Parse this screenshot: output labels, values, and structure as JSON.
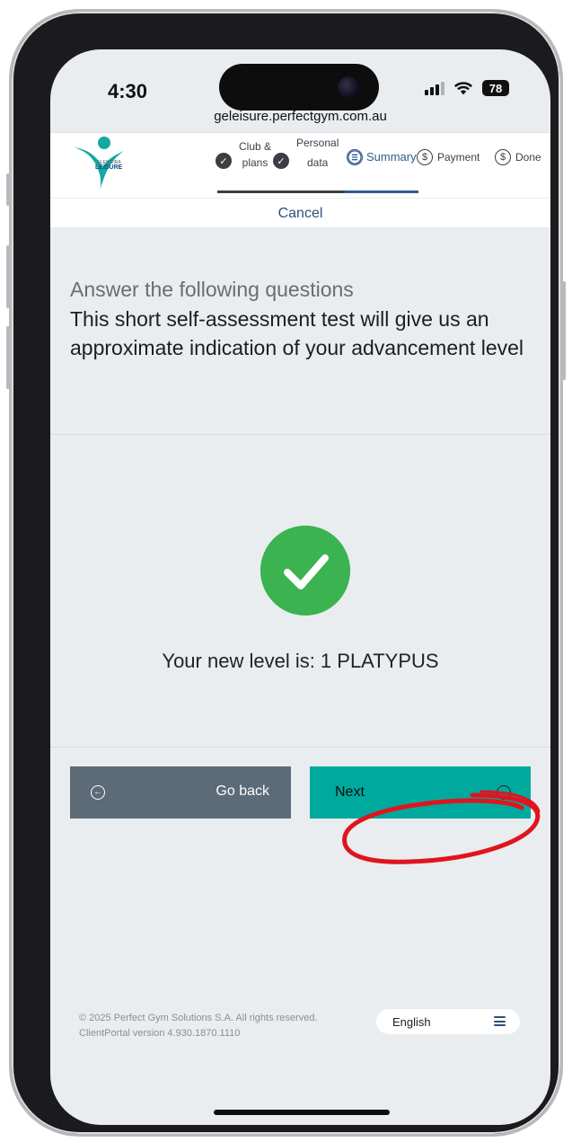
{
  "status_bar": {
    "time": "4:30",
    "battery": "78",
    "url": "geleisure.perfectgym.com.au"
  },
  "header": {
    "logo": {
      "line1": "GLEN EIRA",
      "line2": "LEISURE"
    },
    "steps": [
      {
        "line1": "Club &",
        "line2": "plans",
        "state": "done",
        "icon": "check-icon"
      },
      {
        "line1": "Personal",
        "line2": "data",
        "state": "done",
        "icon": "check-icon"
      },
      {
        "line1": "Summary",
        "line2": "",
        "state": "active",
        "icon": "list-icon"
      },
      {
        "line1": "Payment",
        "line2": "",
        "state": "todo",
        "icon": "dollar-icon"
      },
      {
        "line1": "Done",
        "line2": "",
        "state": "todo",
        "icon": "dollar-icon"
      }
    ],
    "cancel_label": "Cancel"
  },
  "intro": {
    "title": "Answer the following questions",
    "text": "This short self-assessment test will give us an approximate indication of your advancement level"
  },
  "result": {
    "level_text": "Your new level is: 1 PLATYPUS"
  },
  "buttons": {
    "back_label": "Go back",
    "next_label": "Next"
  },
  "footer": {
    "copyright": "© 2025 Perfect Gym Solutions S.A. All rights reserved. ClientPortal version 4.930.1870.1110",
    "language": "English"
  },
  "colors": {
    "accent": "#00a99d",
    "back_button": "#5c6b78",
    "success": "#3bb350",
    "annotation": "#e0141e",
    "link": "#2f4f7a"
  }
}
